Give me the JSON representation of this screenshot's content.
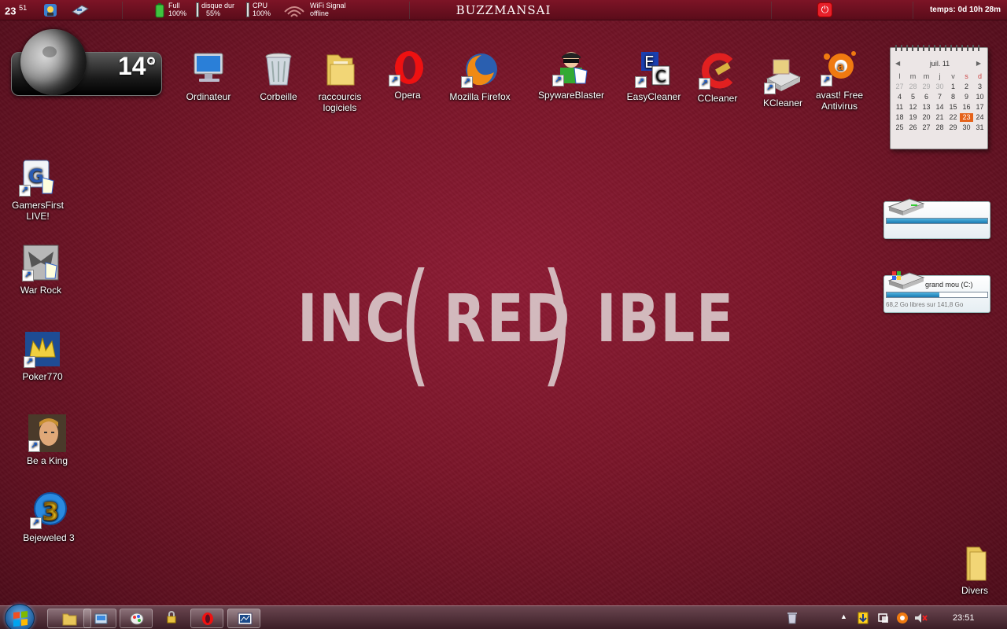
{
  "topbar": {
    "clock_hour": "23",
    "clock_min": "51",
    "battery_label": "Full",
    "battery_value": "100%",
    "disk_label": "disque dur",
    "disk_value": "55%",
    "cpu_label": "CPU",
    "cpu_value": "100%",
    "wifi_label": "WiFi Signal",
    "wifi_value": "offline",
    "title": "BUZZMANSAI",
    "uptime": "temps: 0d 10h 28m"
  },
  "weather": {
    "temperature": "14°",
    "unit": "c"
  },
  "desktop_icons": {
    "ordinateur": "Ordinateur",
    "corbeille": "Corbeille",
    "raccourcis_1": "raccourcis",
    "raccourcis_2": "logiciels",
    "opera": "Opera",
    "firefox": "Mozilla Firefox",
    "spywareblaster": "SpywareBlaster",
    "easycleaner": "EasyCleaner",
    "ccleaner": "CCleaner",
    "kcleaner": "KCleaner",
    "avast_1": "avast! Free",
    "avast_2": "Antivirus",
    "gamersfirst_1": "GamersFirst",
    "gamersfirst_2": "LIVE!",
    "warrock": "War Rock",
    "poker770": "Poker770",
    "beaking": "Be a King",
    "bejeweled": "Bejeweled 3",
    "divers": "Divers"
  },
  "logo": {
    "part1": "INC",
    "open": "(",
    "part2": "RED",
    "close": ")",
    "part3": "IBLE"
  },
  "calendar": {
    "month": "juil. 11",
    "days_of_week": [
      "l",
      "m",
      "m",
      "j",
      "v",
      "s",
      "d"
    ],
    "weeks": [
      [
        "27",
        "28",
        "29",
        "30",
        "1",
        "2",
        "3"
      ],
      [
        "4",
        "5",
        "6",
        "7",
        "8",
        "9",
        "10"
      ],
      [
        "11",
        "12",
        "13",
        "14",
        "15",
        "16",
        "17"
      ],
      [
        "18",
        "19",
        "20",
        "21",
        "22",
        "23",
        "24"
      ],
      [
        "25",
        "26",
        "27",
        "28",
        "29",
        "30",
        "31"
      ]
    ],
    "today": "23"
  },
  "drives": [
    {
      "name": "",
      "usage": 1.0,
      "free": ""
    },
    {
      "name": "grand mou (C:)",
      "usage": 0.52,
      "free": "68,2 Go libres sur 141,8 Go"
    }
  ],
  "taskbar": {
    "clock": "23:51"
  },
  "colors": {
    "accent": "#7a1529",
    "today": "#e5621a"
  }
}
